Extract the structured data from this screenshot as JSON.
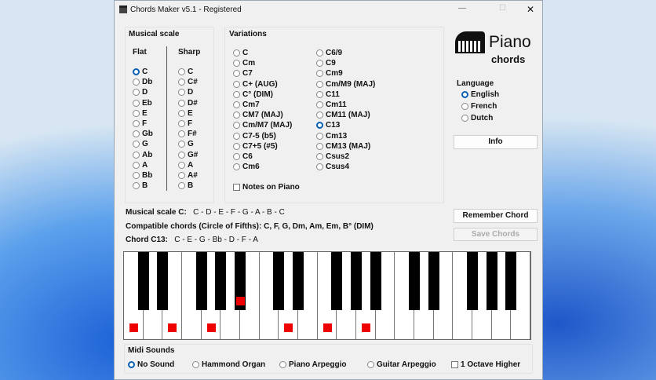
{
  "window": {
    "title": "Chords Maker v5.1 - Registered",
    "minimize": "—",
    "maximize": "☐",
    "close": "✕"
  },
  "musical_scale": {
    "title": "Musical scale",
    "flat_label": "Flat",
    "sharp_label": "Sharp",
    "flat": [
      "C",
      "Db",
      "D",
      "Eb",
      "E",
      "F",
      "Gb",
      "G",
      "Ab",
      "A",
      "Bb",
      "B"
    ],
    "sharp": [
      "C",
      "C#",
      "D",
      "D#",
      "E",
      "F",
      "F#",
      "G",
      "G#",
      "A",
      "A#",
      "B"
    ],
    "selected_flat": 0
  },
  "variations": {
    "title": "Variations",
    "col1": [
      "C",
      "Cm",
      "C7",
      "C+ (AUG)",
      "C° (DIM)",
      "Cm7",
      "CM7 (MAJ)",
      "Cm/M7 (MAJ)",
      "C7-5 (b5)",
      "C7+5 (#5)",
      "C6",
      "Cm6"
    ],
    "col2": [
      "C6/9",
      "C9",
      "Cm9",
      "Cm/M9 (MAJ)",
      "C11",
      "Cm11",
      "CM11 (MAJ)",
      "C13",
      "Cm13",
      "CM13 (MAJ)",
      "Csus2",
      "Csus4"
    ],
    "selected": "C13",
    "notes_on_piano": "Notes on Piano"
  },
  "logo": {
    "word1": "Piano",
    "word2": "chords"
  },
  "language": {
    "title": "Language",
    "options": [
      "English",
      "French",
      "Dutch"
    ],
    "selected": 0
  },
  "buttons": {
    "info": "Info",
    "remember": "Remember Chord",
    "save": "Save Chords"
  },
  "info": {
    "scale_label": "Musical scale C:",
    "scale_value": "C - D - E - F - G - A - B - C",
    "compat_label": "Compatible chords (Circle of Fifths):",
    "compat_value": "C, F, G, Dm, Am, Em, B° (DIM)",
    "chord_label": "Chord C13:",
    "chord_value": "C - E - G - Bb - D - F - A"
  },
  "keyboard": {
    "white_keys": 21,
    "highlighted_white": [
      0,
      2,
      4,
      8,
      10,
      12
    ],
    "highlighted_black": [
      "A#1"
    ]
  },
  "midi": {
    "title": "Midi Sounds",
    "options": [
      "No Sound",
      "Hammond Organ",
      "Piano Arpeggio",
      "Guitar Arpeggio"
    ],
    "selected": 0,
    "octave": "1 Octave Higher"
  }
}
